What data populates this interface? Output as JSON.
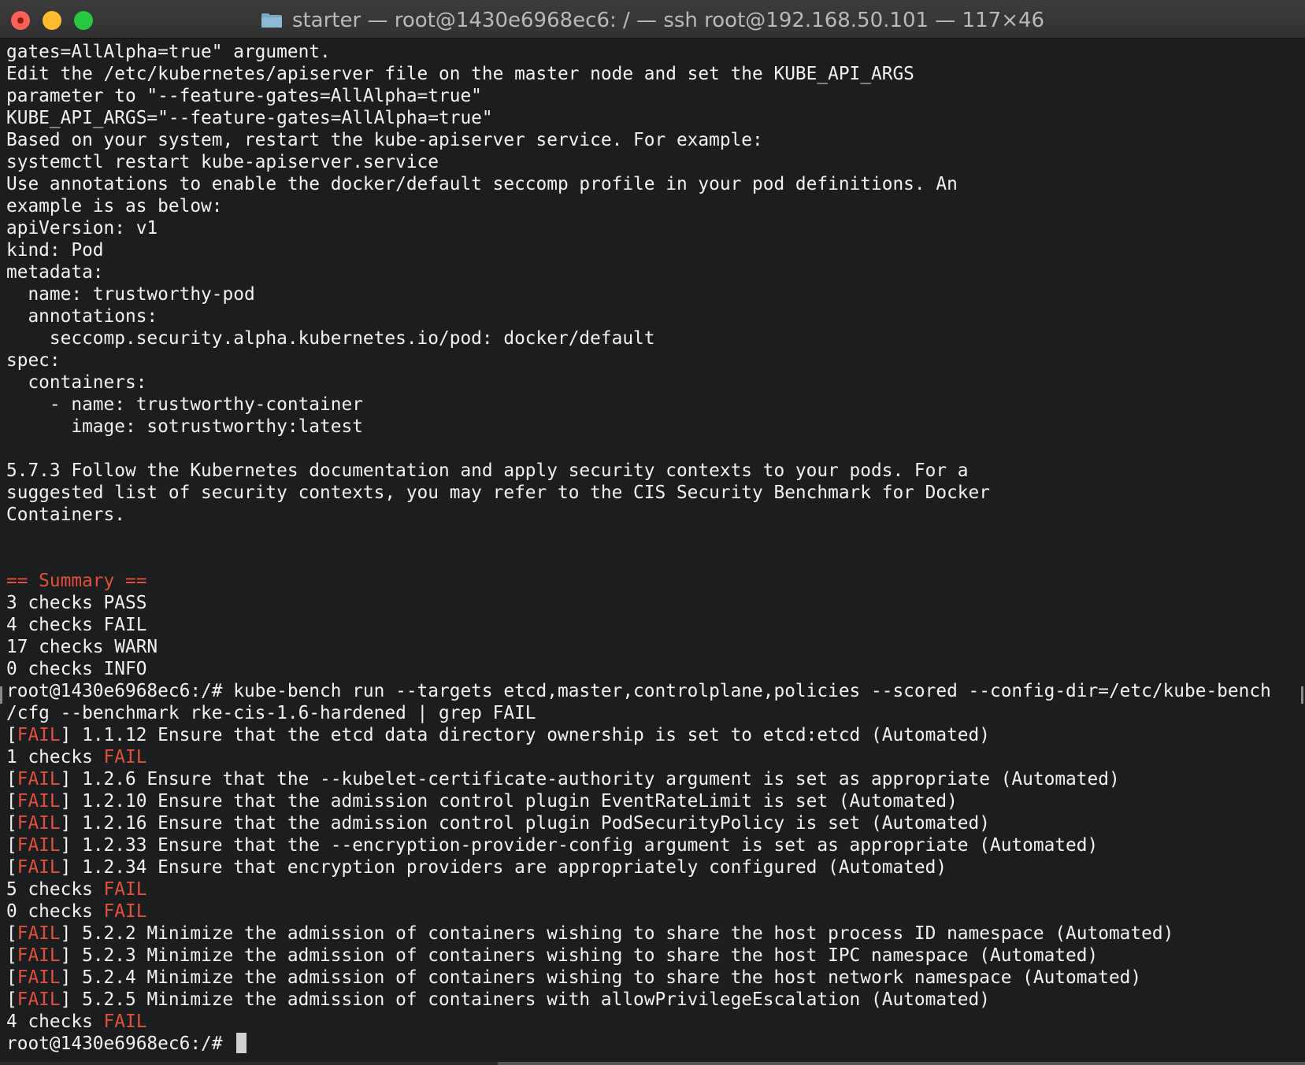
{
  "window": {
    "title": "starter — root@1430e6968ec6: / — ssh root@192.168.50.101 — 117×46",
    "icon": "folder-icon",
    "controls": [
      "close",
      "minimize",
      "zoom"
    ]
  },
  "colors": {
    "background": "#1b1d1e",
    "text": "#f2f2f2",
    "accent_red": "#e2503c"
  },
  "terminal": {
    "lines": [
      "gates=AllAlpha=true\" argument.",
      "Edit the /etc/kubernetes/apiserver file on the master node and set the KUBE_API_ARGS",
      "parameter to \"--feature-gates=AllAlpha=true\"",
      "KUBE_API_ARGS=\"--feature-gates=AllAlpha=true\"",
      "Based on your system, restart the kube-apiserver service. For example:",
      "systemctl restart kube-apiserver.service",
      "Use annotations to enable the docker/default seccomp profile in your pod definitions. An",
      "example is as below:",
      "apiVersion: v1",
      "kind: Pod",
      "metadata:",
      "  name: trustworthy-pod",
      "  annotations:",
      "    seccomp.security.alpha.kubernetes.io/pod: docker/default",
      "spec:",
      "  containers:",
      "    - name: trustworthy-container",
      "      image: sotrustworthy:latest",
      "",
      "5.7.3 Follow the Kubernetes documentation and apply security contexts to your pods. For a",
      "suggested list of security contexts, you may refer to the CIS Security Benchmark for Docker",
      "Containers.",
      "",
      "",
      "== Summary ==",
      "3 checks PASS",
      "4 checks FAIL",
      "17 checks WARN",
      "0 checks INFO",
      "root@1430e6968ec6:/# kube-bench run --targets etcd,master,controlplane,policies --scored --config-dir=/etc/kube-bench",
      "/cfg --benchmark rke-cis-1.6-hardened | grep FAIL",
      "[FAIL] 1.1.12 Ensure that the etcd data directory ownership is set to etcd:etcd (Automated)",
      "1 checks FAIL",
      "[FAIL] 1.2.6 Ensure that the --kubelet-certificate-authority argument is set as appropriate (Automated)",
      "[FAIL] 1.2.10 Ensure that the admission control plugin EventRateLimit is set (Automated)",
      "[FAIL] 1.2.16 Ensure that the admission control plugin PodSecurityPolicy is set (Automated)",
      "[FAIL] 1.2.33 Ensure that the --encryption-provider-config argument is set as appropriate (Automated)",
      "[FAIL] 1.2.34 Ensure that encryption providers are appropriately configured (Automated)",
      "5 checks FAIL",
      "0 checks FAIL",
      "[FAIL] 5.2.2 Minimize the admission of containers wishing to share the host process ID namespace (Automated)",
      "[FAIL] 5.2.3 Minimize the admission of containers wishing to share the host IPC namespace (Automated)",
      "[FAIL] 5.2.4 Minimize the admission of containers wishing to share the host network namespace (Automated)",
      "[FAIL] 5.2.5 Minimize the admission of containers with allowPrivilegeEscalation (Automated)",
      "4 checks FAIL",
      "root@1430e6968ec6:/# "
    ],
    "highlight_word": "FAIL",
    "summary_heading": "== Summary =="
  }
}
